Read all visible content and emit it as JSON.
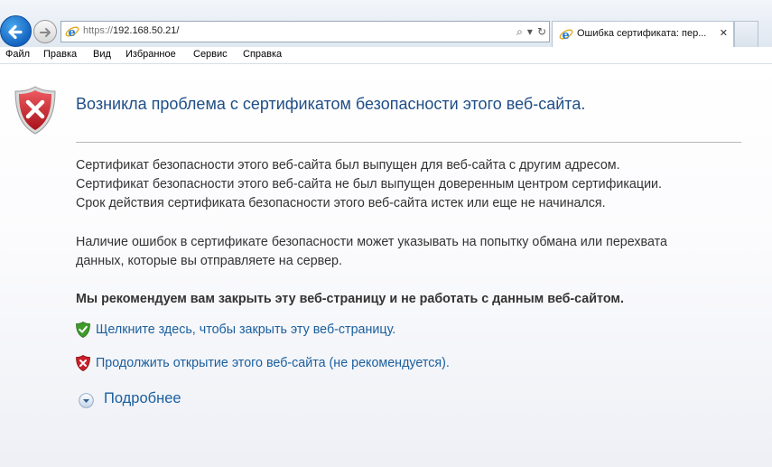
{
  "browser": {
    "address": {
      "scheme": "https://",
      "host": "192.168.50.21/"
    },
    "tab": {
      "title": "Ошибка сертификата: пер..."
    },
    "menu": [
      "Файл",
      "Правка",
      "Вид",
      "Избранное",
      "Сервис",
      "Справка"
    ]
  },
  "page": {
    "heading": "Возникла проблема с сертификатом безопасности этого веб-сайта.",
    "reasons": [
      "Сертификат безопасности этого веб-сайта был выпущен для веб-сайта с другим адресом.",
      "Сертификат безопасности этого веб-сайта не был выпущен доверенным центром сертификации.",
      "Срок действия сертификата безопасности этого веб-сайта истек или еще не начинался."
    ],
    "warning": [
      "Наличие ошибок в сертификате безопасности может указывать на попытку обмана или перехвата",
      "данных, которые вы отправляете на сервер."
    ],
    "recommendation": "Мы рекомендуем вам закрыть эту веб-страницу и не работать с данным веб-сайтом.",
    "close_link": "Щелкните здесь, чтобы закрыть эту веб-страницу.",
    "continue_link": "Продолжить открытие этого веб-сайта (не рекомендуется).",
    "more_info": "Подробнее"
  },
  "colors": {
    "heading": "#1f4e87",
    "link": "#1a5f9e",
    "shield_red": "#c8202a",
    "check_green": "#3f9b2c"
  }
}
